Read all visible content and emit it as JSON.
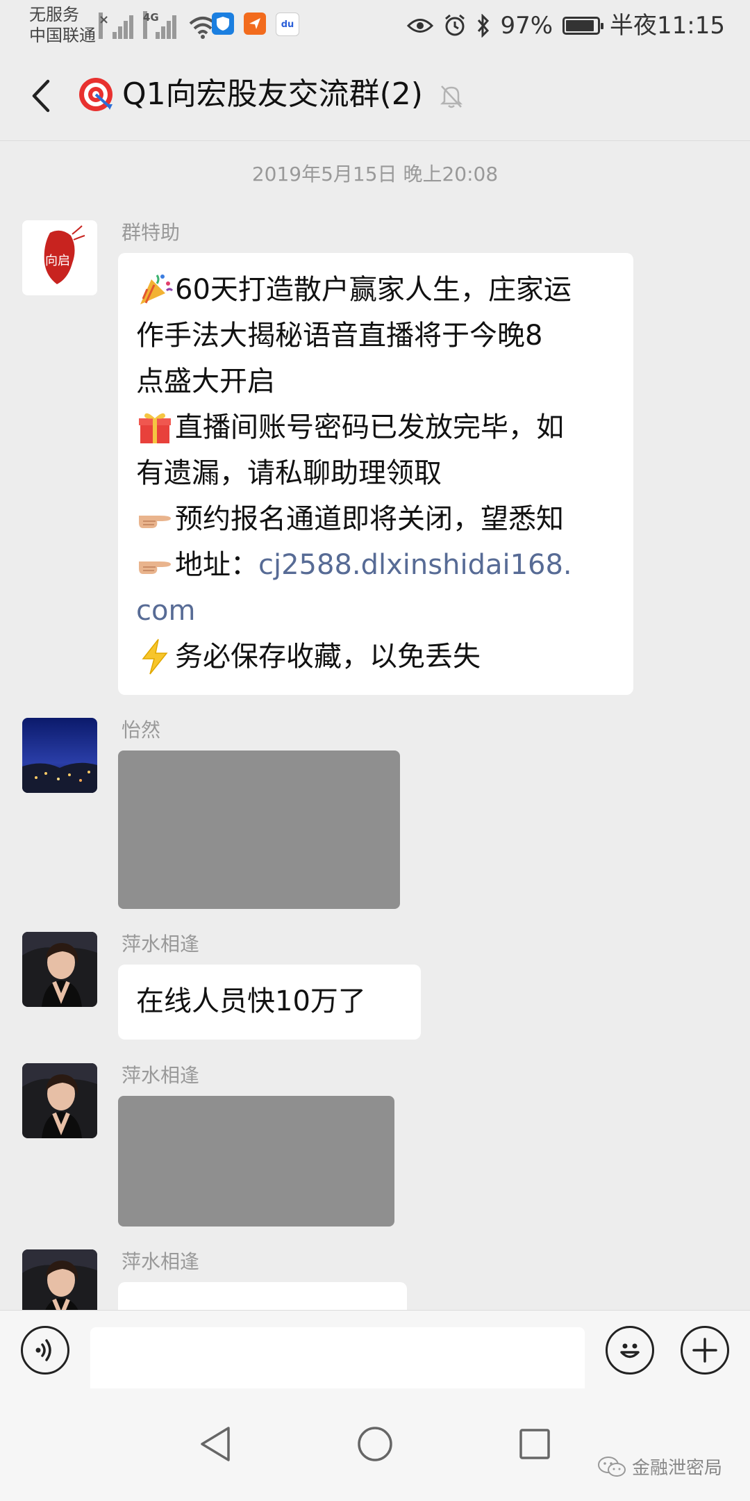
{
  "status_bar": {
    "carrier_line1": "无服务",
    "carrier_line2": "中国联通",
    "network": "4G",
    "battery": "97%",
    "time": "半夜11:15"
  },
  "nav": {
    "title": "Q1向宏股友交流群(2)"
  },
  "chat": {
    "time_separator": "2019年5月15日 晚上20:08",
    "messages": [
      {
        "sender": "群特助",
        "avatar_text": "向启",
        "lines": [
          "60天打造散户赢家人生，庄家运",
          "作手法大揭秘语音直播将于今晚8",
          "点盛大开启",
          "直播间账号密码已发放完毕，如",
          "有遗漏，请私聊助理领取",
          "预约报名通道即将关闭，望悉知",
          "地址：",
          "cj2588.dlxinshidai168.",
          "com",
          "务必保存收藏，以免丢失"
        ]
      },
      {
        "sender": "怡然",
        "type": "image"
      },
      {
        "sender": "萍水相逢",
        "text": "在线人员快10万了"
      },
      {
        "sender": "萍水相逢",
        "type": "image"
      },
      {
        "sender": "萍水相逢",
        "type": "text-partial"
      }
    ]
  },
  "input": {
    "value": "",
    "placeholder": ""
  },
  "watermark": {
    "text": "金融泄密局"
  },
  "colors": {
    "background": "#ededed",
    "bubble": "#ffffff",
    "link": "#576b95",
    "image_placeholder": "#8f8f8f"
  }
}
